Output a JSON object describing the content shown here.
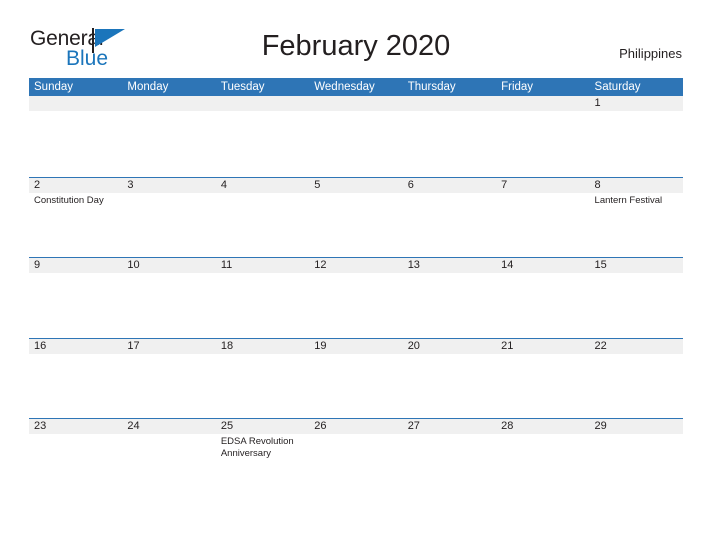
{
  "brand": {
    "name_part1": "General",
    "name_part2": "Blue",
    "flag_color": "#1b75bb"
  },
  "header": {
    "title": "February 2020",
    "region": "Philippines"
  },
  "theme": {
    "header_blue": "#2e75b6",
    "date_band_gray": "#f0f0f0",
    "text": "#231f20"
  },
  "calendar": {
    "month": "February",
    "year": "2020",
    "weekday_headers": [
      "Sunday",
      "Monday",
      "Tuesday",
      "Wednesday",
      "Thursday",
      "Friday",
      "Saturday"
    ],
    "weeks": [
      {
        "days": [
          {
            "num": "",
            "events": []
          },
          {
            "num": "",
            "events": []
          },
          {
            "num": "",
            "events": []
          },
          {
            "num": "",
            "events": []
          },
          {
            "num": "",
            "events": []
          },
          {
            "num": "",
            "events": []
          },
          {
            "num": "1",
            "events": []
          }
        ]
      },
      {
        "days": [
          {
            "num": "2",
            "events": [
              "Constitution Day"
            ]
          },
          {
            "num": "3",
            "events": []
          },
          {
            "num": "4",
            "events": []
          },
          {
            "num": "5",
            "events": []
          },
          {
            "num": "6",
            "events": []
          },
          {
            "num": "7",
            "events": []
          },
          {
            "num": "8",
            "events": [
              "Lantern Festival"
            ]
          }
        ]
      },
      {
        "days": [
          {
            "num": "9",
            "events": []
          },
          {
            "num": "10",
            "events": []
          },
          {
            "num": "11",
            "events": []
          },
          {
            "num": "12",
            "events": []
          },
          {
            "num": "13",
            "events": []
          },
          {
            "num": "14",
            "events": []
          },
          {
            "num": "15",
            "events": []
          }
        ]
      },
      {
        "days": [
          {
            "num": "16",
            "events": []
          },
          {
            "num": "17",
            "events": []
          },
          {
            "num": "18",
            "events": []
          },
          {
            "num": "19",
            "events": []
          },
          {
            "num": "20",
            "events": []
          },
          {
            "num": "21",
            "events": []
          },
          {
            "num": "22",
            "events": []
          }
        ]
      },
      {
        "days": [
          {
            "num": "23",
            "events": []
          },
          {
            "num": "24",
            "events": []
          },
          {
            "num": "25",
            "events": [
              "EDSA Revolution Anniversary"
            ]
          },
          {
            "num": "26",
            "events": []
          },
          {
            "num": "27",
            "events": []
          },
          {
            "num": "28",
            "events": []
          },
          {
            "num": "29",
            "events": []
          }
        ]
      }
    ]
  }
}
